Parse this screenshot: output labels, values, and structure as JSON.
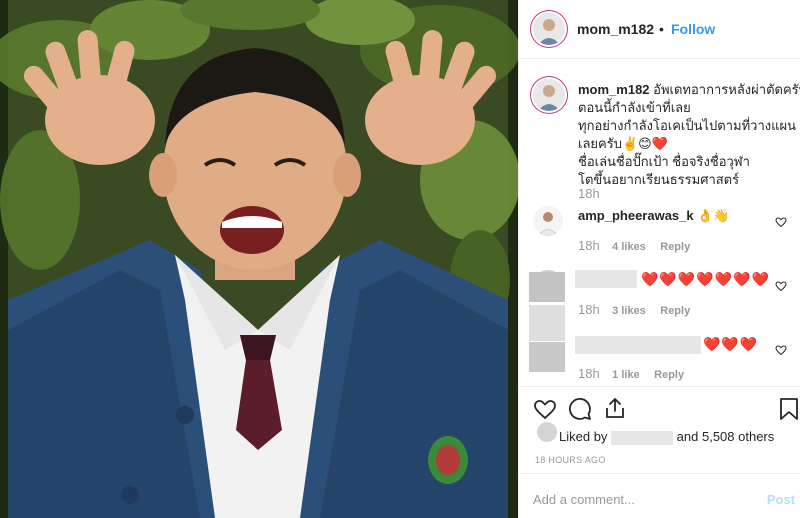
{
  "post": {
    "username": "mom_m182",
    "separator": "•",
    "follow_label": "Follow"
  },
  "caption": {
    "username": "mom_m182",
    "lines": [
      "อัพเดทอาการหลังผ่าตัดครับ",
      "ตอนนี้กำลังเข้าที่เลย",
      "ทุกอย่างกำลังโอเคเป็นไปตามที่วางแผน",
      "เลยครับ✌️😊❤️",
      "ชื่อเล่นชื่อปั๊กเป้า ชื่อจริงชื่อวุฬา",
      "โตขึ้นอยากเรียนธรรมศาสตร์"
    ],
    "time": "18h"
  },
  "comments": [
    {
      "username": "amp_pheerawas_k",
      "text": "👌👋",
      "time": "18h",
      "likes": "4 likes",
      "reply": "Reply"
    },
    {
      "username": "",
      "text": "❤️❤️❤️❤️❤️❤️❤️",
      "time": "18h",
      "likes": "3 likes",
      "reply": "Reply"
    },
    {
      "username": "",
      "text": "❤️❤️❤️",
      "time": "18h",
      "likes": "1 like",
      "reply": "Reply"
    }
  ],
  "likes": {
    "prefix": "Liked by",
    "suffix": "and 5,508 others"
  },
  "posted_ago": "18 HOURS AGO",
  "add_comment": {
    "placeholder": "Add a comment...",
    "post_label": "Post"
  },
  "icons": {
    "like": "heart-icon",
    "comment": "comment-icon",
    "share": "share-icon",
    "save": "bookmark-icon",
    "comment_like": "heart-outline-icon"
  },
  "colors": {
    "accent": "#3897f0",
    "muted": "#999999",
    "heart": "#ed4956",
    "post_disabled": "#b2dffc"
  }
}
